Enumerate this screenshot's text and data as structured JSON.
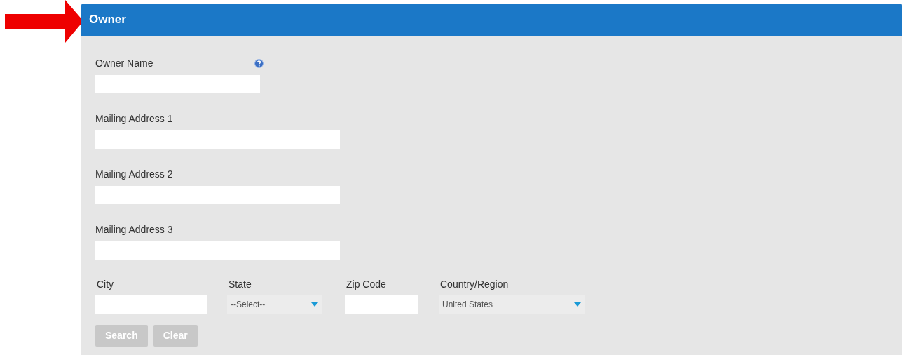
{
  "panel": {
    "title": "Owner"
  },
  "owner_name": {
    "label": "Owner Name"
  },
  "addresses": [
    {
      "label": "Mailing Address 1"
    },
    {
      "label": "Mailing Address 2"
    },
    {
      "label": "Mailing Address 3"
    }
  ],
  "location_fields": [
    {
      "kind": "text",
      "label": "City"
    },
    {
      "kind": "select",
      "label": "State",
      "value": "--Select--"
    },
    {
      "kind": "text",
      "label": "Zip Code"
    },
    {
      "kind": "select",
      "label": "Country/Region",
      "value": "United States"
    }
  ],
  "buttons": [
    {
      "label": "Search",
      "disabled": true
    },
    {
      "label": "Clear",
      "disabled": true
    }
  ]
}
